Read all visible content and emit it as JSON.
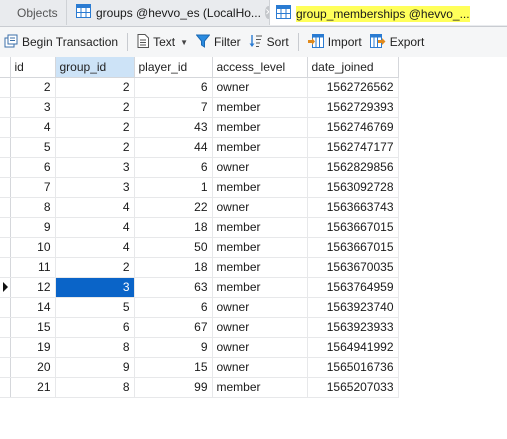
{
  "tabs": {
    "objects": "Objects",
    "groups": "groups @hevvo_es (LocalHo...",
    "group_memberships": "group_memberships @hevvo_..."
  },
  "toolbar": {
    "begin_transaction": "Begin Transaction",
    "text": "Text",
    "filter": "Filter",
    "sort": "Sort",
    "import": "Import",
    "export": "Export"
  },
  "table": {
    "columns": [
      "id",
      "group_id",
      "player_id",
      "access_level",
      "date_joined"
    ],
    "selected_column": "group_id",
    "rows": [
      {
        "id": "2",
        "group_id": "2",
        "player_id": "6",
        "access_level": "owner",
        "date_joined": "1562726562"
      },
      {
        "id": "3",
        "group_id": "2",
        "player_id": "7",
        "access_level": "member",
        "date_joined": "1562729393"
      },
      {
        "id": "4",
        "group_id": "2",
        "player_id": "43",
        "access_level": "member",
        "date_joined": "1562746769"
      },
      {
        "id": "5",
        "group_id": "2",
        "player_id": "44",
        "access_level": "member",
        "date_joined": "1562747177"
      },
      {
        "id": "6",
        "group_id": "3",
        "player_id": "6",
        "access_level": "owner",
        "date_joined": "1562829856"
      },
      {
        "id": "7",
        "group_id": "3",
        "player_id": "1",
        "access_level": "member",
        "date_joined": "1563092728"
      },
      {
        "id": "8",
        "group_id": "4",
        "player_id": "22",
        "access_level": "owner",
        "date_joined": "1563663743"
      },
      {
        "id": "9",
        "group_id": "4",
        "player_id": "18",
        "access_level": "member",
        "date_joined": "1563667015"
      },
      {
        "id": "10",
        "group_id": "4",
        "player_id": "50",
        "access_level": "member",
        "date_joined": "1563667015"
      },
      {
        "id": "11",
        "group_id": "2",
        "player_id": "18",
        "access_level": "member",
        "date_joined": "1563670035"
      },
      {
        "id": "12",
        "group_id": "3",
        "player_id": "63",
        "access_level": "member",
        "date_joined": "1563764959",
        "current": true
      },
      {
        "id": "14",
        "group_id": "5",
        "player_id": "6",
        "access_level": "owner",
        "date_joined": "1563923740"
      },
      {
        "id": "15",
        "group_id": "6",
        "player_id": "67",
        "access_level": "owner",
        "date_joined": "1563923933"
      },
      {
        "id": "19",
        "group_id": "8",
        "player_id": "9",
        "access_level": "owner",
        "date_joined": "1564941992"
      },
      {
        "id": "20",
        "group_id": "9",
        "player_id": "15",
        "access_level": "owner",
        "date_joined": "1565016736"
      },
      {
        "id": "21",
        "group_id": "8",
        "player_id": "99",
        "access_level": "member",
        "date_joined": "1565207033"
      }
    ]
  },
  "colors": {
    "tab_highlight": "#ffff5a",
    "selected_cell": "#0a64c8",
    "selected_header": "#cde3f7"
  }
}
